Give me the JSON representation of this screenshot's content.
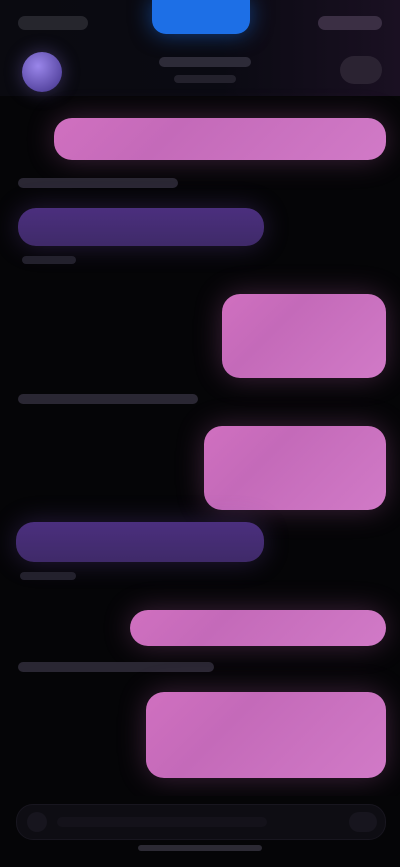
{
  "colors": {
    "background": "#050507",
    "incoming_bubble": "#432c72",
    "outgoing_bubble": "#d070c0",
    "status_pill": "#1d6fe6"
  },
  "header": {
    "back_icon": "chevron-left-icon",
    "avatar_icon": "avatar-icon",
    "action_icon": "more-icon"
  },
  "messages": [
    {
      "side": "outgoing"
    },
    {
      "side": "incoming"
    },
    {
      "side": "outgoing"
    },
    {
      "side": "outgoing"
    },
    {
      "side": "incoming"
    },
    {
      "side": "outgoing"
    },
    {
      "side": "outgoing"
    }
  ],
  "composer": {
    "plus_icon": "plus-icon",
    "send_icon": "send-icon"
  }
}
